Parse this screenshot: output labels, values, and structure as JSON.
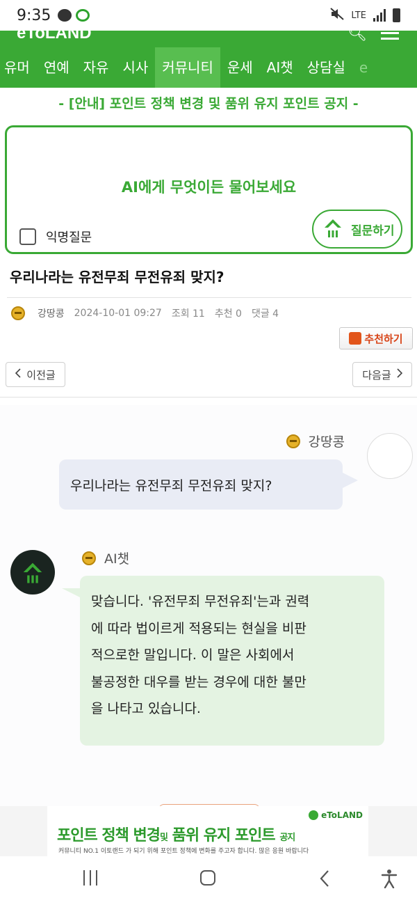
{
  "status_bar": {
    "time": "9:35",
    "network": "LTE"
  },
  "header": {
    "logo": "eToLAND"
  },
  "nav": {
    "items": [
      "유머",
      "연예",
      "자유",
      "시사",
      "커뮤니티",
      "운세",
      "AI챗",
      "상담실",
      "e"
    ],
    "active_index": 4
  },
  "notice": "- [안내] 포인트 정책 변경 및 품위 유지 포인트 공지 -",
  "ask_box": {
    "placeholder": "AI에게 무엇이든 물어보세요",
    "anonymous_label": "익명질문",
    "submit_label": "질문하기"
  },
  "post": {
    "title": "우리나라는 유전무죄 무전유죄 맞지?",
    "author": "강땅콩",
    "datetime": "2024-10-01 09:27",
    "views": "조회 11",
    "recommends": "추천 0",
    "comments": "댓글 4",
    "recommend_button": "추천하기",
    "prev_label": "이전글",
    "next_label": "다음글"
  },
  "chat": {
    "user_name": "강땅콩",
    "user_message": "우리나라는 유전무죄 무전유죄 맞지?",
    "ai_name": "AI챗",
    "ai_lines": [
      "맞습니다. '유전무죄 무전유죄'는과 권력",
      "에 따라 법이르게 적용되는 현실을 비판",
      "적으로한 말입니다. 이 말은 사회에서",
      "불공정한 대우를 받는 경우에 대한 불만",
      "을 나타고 있습니다."
    ]
  },
  "banner": {
    "logo": "eToLAND",
    "title_part1": "포인트 정책 변경",
    "title_and": "및",
    "title_part2": "품위 유지 포인트",
    "title_suffix": "공지",
    "subtitle": "커뮤니티 NO.1 이토랜드 가 되기 위해 포인트 정책에 변화를 주고자 합니다. 많은 응원 바랍니다"
  },
  "colors": {
    "brand_green": "#3aa935",
    "user_bubble": "#e9ecf5",
    "ai_bubble": "#e4f3e2",
    "recommend": "#d8461a"
  }
}
